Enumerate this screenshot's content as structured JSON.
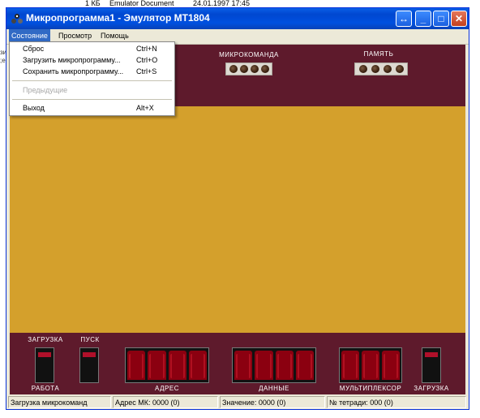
{
  "background": {
    "strip": {
      "col1": "1 КБ",
      "col2": "Emulator Document",
      "col3": "24.01.1997 17:45"
    },
    "side": [
      "зиг",
      ";ек"
    ]
  },
  "window": {
    "title": "Микропрограмма1 - Эмулятор МТ1804",
    "controls": {
      "restore": "↔",
      "minimize": "_",
      "maximize": "□",
      "close": "✕"
    }
  },
  "menu": {
    "items": [
      "Состояние",
      "Просмотр",
      "Помощь"
    ],
    "dropdown": [
      {
        "label": "Сброс",
        "shortcut": "Ctrl+N"
      },
      {
        "label": "Загрузить микропрограмму...",
        "shortcut": "Ctrl+O"
      },
      {
        "label": "Сохранить микропрограмму...",
        "shortcut": "Ctrl+S"
      },
      {
        "label": "Предыдущие",
        "shortcut": ""
      },
      {
        "label": "Выход",
        "shortcut": "Alt+X"
      }
    ]
  },
  "top_panel": {
    "microcommand_label": "МИКРОКОМАНДА",
    "memory_label": "ПАМЯТЬ"
  },
  "bottom_panel": {
    "load_label": "ЗАГРУЗКА",
    "start_label": "ПУСК",
    "work_label": "РАБОТА",
    "address_label": "АДРЕС",
    "data_label": "ДАННЫЕ",
    "mux_label": "МУЛЬТИПЛЕКСОР",
    "load2_label": "ЗАГРУЗКА"
  },
  "status": {
    "mode": "Загрузка микрокоманд",
    "address": "Адрес МК: 0000 (0)",
    "value": "Значение: 0000 (0)",
    "tetrad": "№ тетради: 000 (0)"
  },
  "colors": {
    "panel": "#5e1a2c",
    "workspace": "#d4a02c",
    "digit": "#8b0010"
  }
}
